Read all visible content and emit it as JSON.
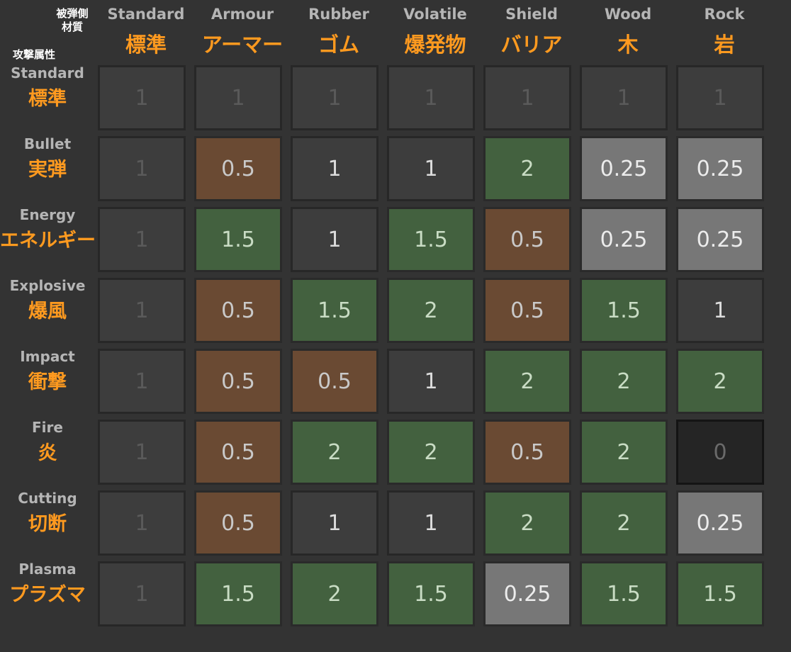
{
  "labels": {
    "defender_line1": "被弾側",
    "defender_line2": "材質",
    "attacker": "攻撃属性"
  },
  "columns": [
    {
      "en": "Standard",
      "jp": "標準"
    },
    {
      "en": "Armour",
      "jp": "アーマー"
    },
    {
      "en": "Rubber",
      "jp": "ゴム"
    },
    {
      "en": "Volatile",
      "jp": "爆発物"
    },
    {
      "en": "Shield",
      "jp": "バリア"
    },
    {
      "en": "Wood",
      "jp": "木"
    },
    {
      "en": "Rock",
      "jp": "岩"
    }
  ],
  "rows": [
    {
      "en": "Standard",
      "jp": "標準",
      "values": [
        "1",
        "1",
        "1",
        "1",
        "1",
        "1",
        "1"
      ]
    },
    {
      "en": "Bullet",
      "jp": "実弾",
      "values": [
        "1",
        "0.5",
        "1",
        "1",
        "2",
        "0.25",
        "0.25"
      ]
    },
    {
      "en": "Energy",
      "jp": "エネルギー",
      "values": [
        "1",
        "1.5",
        "1",
        "1.5",
        "0.5",
        "0.25",
        "0.25"
      ]
    },
    {
      "en": "Explosive",
      "jp": "爆風",
      "values": [
        "1",
        "0.5",
        "1.5",
        "2",
        "0.5",
        "1.5",
        "1"
      ]
    },
    {
      "en": "Impact",
      "jp": "衝撃",
      "values": [
        "1",
        "0.5",
        "0.5",
        "1",
        "2",
        "2",
        "2"
      ]
    },
    {
      "en": "Fire",
      "jp": "炎",
      "values": [
        "1",
        "0.5",
        "2",
        "2",
        "0.5",
        "2",
        "0"
      ]
    },
    {
      "en": "Cutting",
      "jp": "切断",
      "values": [
        "1",
        "0.5",
        "1",
        "1",
        "2",
        "2",
        "0.25"
      ]
    },
    {
      "en": "Plasma",
      "jp": "プラズマ",
      "values": [
        "1",
        "1.5",
        "2",
        "1.5",
        "0.25",
        "1.5",
        "1.5"
      ]
    }
  ],
  "colors": {
    "background": "#333333",
    "header_orange": "#ff9a1f",
    "neutral": "#3d3d3d",
    "resist": "#6a4a33",
    "weak": "#43613f",
    "strong_resist": "#777777",
    "immune": "#252525"
  }
}
